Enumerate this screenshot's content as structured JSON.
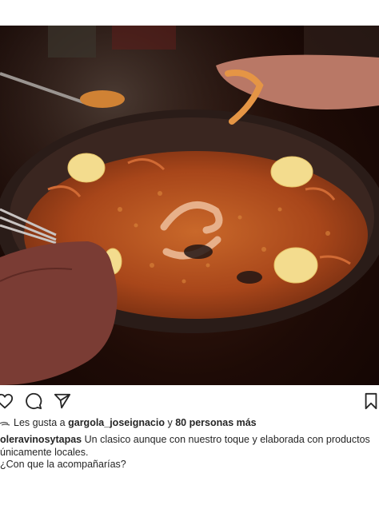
{
  "post": {
    "image_subject": "paella-photo",
    "user_tag_icon": "person-icon",
    "mute_icon": "muted-speaker-icon"
  },
  "actions": {
    "like_icon": "heart-icon",
    "comment_icon": "comment-icon",
    "share_icon": "paper-plane-icon",
    "save_icon": "bookmark-icon"
  },
  "likes": {
    "prefix": "Les gusta a ",
    "user": "gargola_joseignacio",
    "joiner": " y ",
    "others": "80 personas más"
  },
  "caption": {
    "username": "oleravinosytapas",
    "text_line1": " Un clasico aunque con nuestro toque y elaborada con productos",
    "text_line2": "únicamente locales.",
    "text_line3": "¿Con que la acompañarías?"
  },
  "colors": {
    "text": "#262626",
    "photo_dark": "#1e0b06",
    "rice": "#b8541e",
    "lemon": "#f3dc8e"
  }
}
